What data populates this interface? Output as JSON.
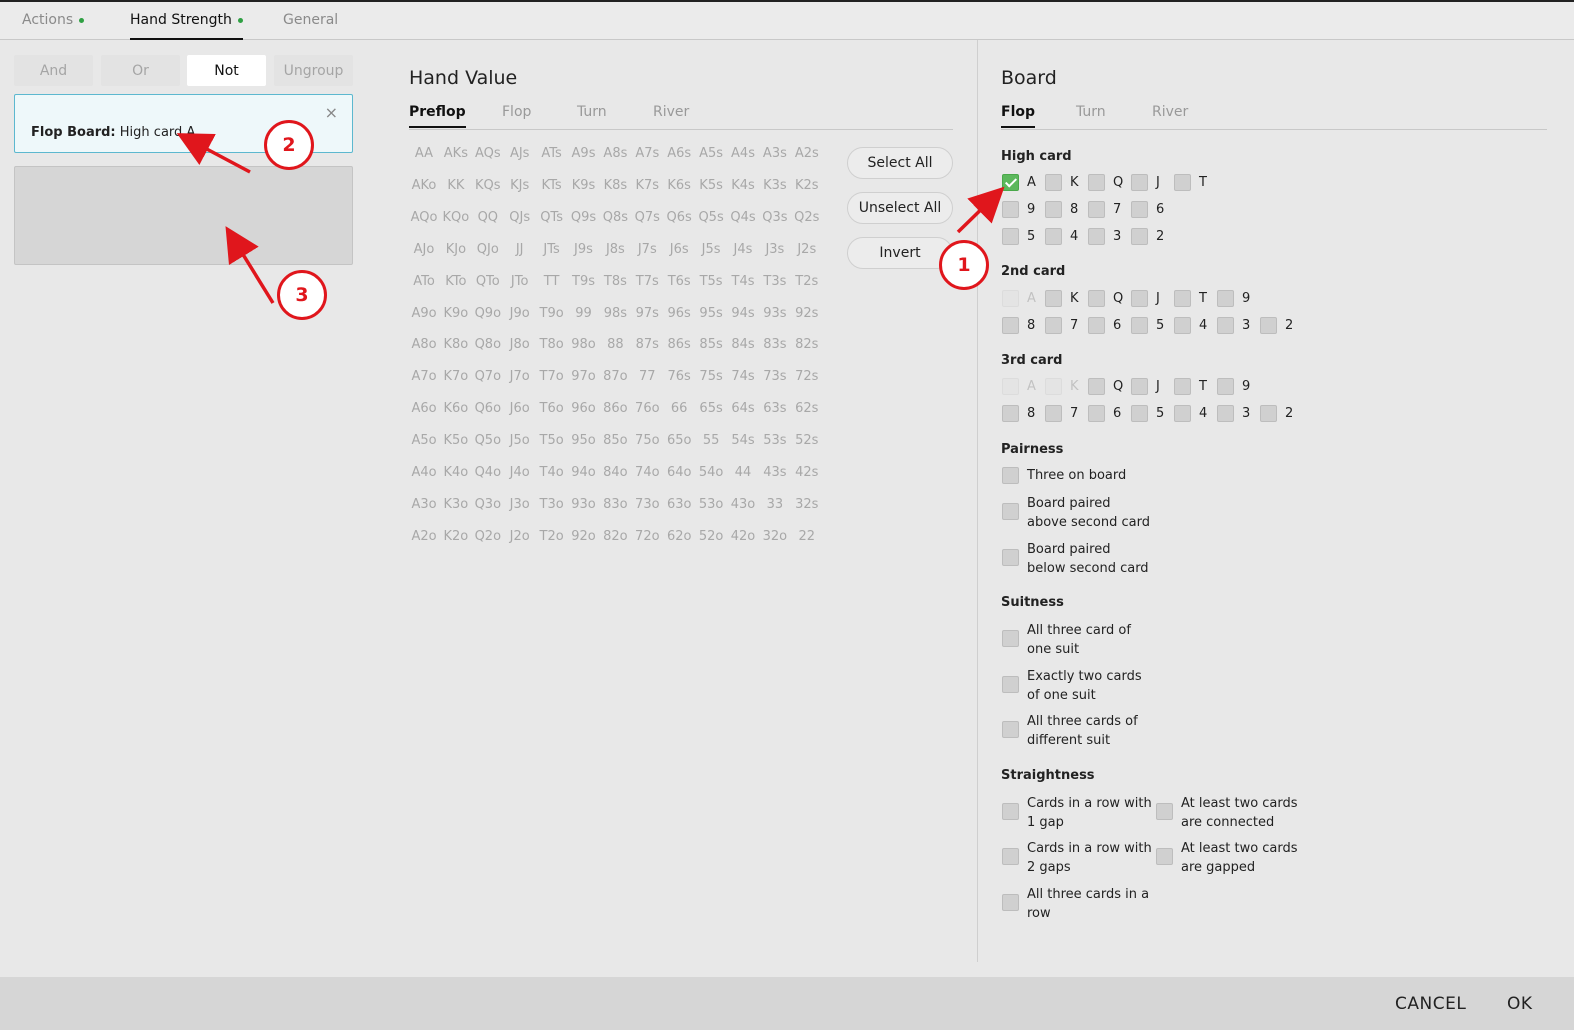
{
  "tabs": [
    {
      "label": "Actions",
      "dot": true
    },
    {
      "label": "Hand Strength",
      "dot": true
    },
    {
      "label": "General",
      "dot": false
    }
  ],
  "logic": {
    "and": "And",
    "or": "Or",
    "not": "Not",
    "ungroup": "Ungroup"
  },
  "filter": {
    "prefix": "Flop Board:",
    "value": "High card A",
    "close": "×"
  },
  "hand_value": {
    "title": "Hand Value",
    "tabs": [
      "Preflop",
      "Flop",
      "Turn",
      "River"
    ],
    "matrix": [
      [
        "AA",
        "AKs",
        "AQs",
        "AJs",
        "ATs",
        "A9s",
        "A8s",
        "A7s",
        "A6s",
        "A5s",
        "A4s",
        "A3s",
        "A2s"
      ],
      [
        "AKo",
        "KK",
        "KQs",
        "KJs",
        "KTs",
        "K9s",
        "K8s",
        "K7s",
        "K6s",
        "K5s",
        "K4s",
        "K3s",
        "K2s"
      ],
      [
        "AQo",
        "KQo",
        "QQ",
        "QJs",
        "QTs",
        "Q9s",
        "Q8s",
        "Q7s",
        "Q6s",
        "Q5s",
        "Q4s",
        "Q3s",
        "Q2s"
      ],
      [
        "AJo",
        "KJo",
        "QJo",
        "JJ",
        "JTs",
        "J9s",
        "J8s",
        "J7s",
        "J6s",
        "J5s",
        "J4s",
        "J3s",
        "J2s"
      ],
      [
        "ATo",
        "KTo",
        "QTo",
        "JTo",
        "TT",
        "T9s",
        "T8s",
        "T7s",
        "T6s",
        "T5s",
        "T4s",
        "T3s",
        "T2s"
      ],
      [
        "A9o",
        "K9o",
        "Q9o",
        "J9o",
        "T9o",
        "99",
        "98s",
        "97s",
        "96s",
        "95s",
        "94s",
        "93s",
        "92s"
      ],
      [
        "A8o",
        "K8o",
        "Q8o",
        "J8o",
        "T8o",
        "98o",
        "88",
        "87s",
        "86s",
        "85s",
        "84s",
        "83s",
        "82s"
      ],
      [
        "A7o",
        "K7o",
        "Q7o",
        "J7o",
        "T7o",
        "97o",
        "87o",
        "77",
        "76s",
        "75s",
        "74s",
        "73s",
        "72s"
      ],
      [
        "A6o",
        "K6o",
        "Q6o",
        "J6o",
        "T6o",
        "96o",
        "86o",
        "76o",
        "66",
        "65s",
        "64s",
        "63s",
        "62s"
      ],
      [
        "A5o",
        "K5o",
        "Q5o",
        "J5o",
        "T5o",
        "95o",
        "85o",
        "75o",
        "65o",
        "55",
        "54s",
        "53s",
        "52s"
      ],
      [
        "A4o",
        "K4o",
        "Q4o",
        "J4o",
        "T4o",
        "94o",
        "84o",
        "74o",
        "64o",
        "54o",
        "44",
        "43s",
        "42s"
      ],
      [
        "A3o",
        "K3o",
        "Q3o",
        "J3o",
        "T3o",
        "93o",
        "83o",
        "73o",
        "63o",
        "53o",
        "43o",
        "33",
        "32s"
      ],
      [
        "A2o",
        "K2o",
        "Q2o",
        "J2o",
        "T2o",
        "92o",
        "82o",
        "72o",
        "62o",
        "52o",
        "42o",
        "32o",
        "22"
      ]
    ],
    "buttons": {
      "select_all": "Select All",
      "unselect_all": "Unselect All",
      "invert": "Invert"
    }
  },
  "board": {
    "title": "Board",
    "tabs": [
      "Flop",
      "Turn",
      "River"
    ],
    "high_card": {
      "label": "High card",
      "rows": [
        [
          {
            "t": "A",
            "checked": true
          },
          {
            "t": "K"
          },
          {
            "t": "Q"
          },
          {
            "t": "J"
          },
          {
            "t": "T"
          }
        ],
        [
          {
            "t": "9"
          },
          {
            "t": "8"
          },
          {
            "t": "7"
          },
          {
            "t": "6"
          }
        ],
        [
          {
            "t": "5"
          },
          {
            "t": "4"
          },
          {
            "t": "3"
          },
          {
            "t": "2"
          }
        ]
      ]
    },
    "second_card": {
      "label": "2nd card",
      "rows": [
        [
          {
            "t": "A",
            "disabled": true
          },
          {
            "t": "K"
          },
          {
            "t": "Q"
          },
          {
            "t": "J"
          },
          {
            "t": "T"
          },
          {
            "t": "9"
          }
        ],
        [
          {
            "t": "8"
          },
          {
            "t": "7"
          },
          {
            "t": "6"
          },
          {
            "t": "5"
          },
          {
            "t": "4"
          },
          {
            "t": "3"
          },
          {
            "t": "2"
          }
        ]
      ]
    },
    "third_card": {
      "label": "3rd card",
      "rows": [
        [
          {
            "t": "A",
            "disabled": true
          },
          {
            "t": "K",
            "disabled": true
          },
          {
            "t": "Q"
          },
          {
            "t": "J"
          },
          {
            "t": "T"
          },
          {
            "t": "9"
          }
        ],
        [
          {
            "t": "8"
          },
          {
            "t": "7"
          },
          {
            "t": "6"
          },
          {
            "t": "5"
          },
          {
            "t": "4"
          },
          {
            "t": "3"
          },
          {
            "t": "2"
          }
        ]
      ]
    },
    "pairness": {
      "label": "Pairness",
      "items": [
        "Three on board",
        "Board paired\nabove second card",
        "Board paired\nbelow second card"
      ]
    },
    "suitness": {
      "label": "Suitness",
      "items": [
        "All three card of\none suit",
        "Exactly two cards\nof one suit",
        "All three cards of\ndifferent suit"
      ]
    },
    "straightness": {
      "label": "Straightness",
      "left": [
        "Cards in a row with\n1 gap",
        "Cards in a row with\n2 gaps",
        "All three cards in a\nrow"
      ],
      "right": [
        "At least two cards\nare connected",
        "At least two cards\nare gapped"
      ]
    }
  },
  "footer": {
    "cancel": "CANCEL",
    "ok": "OK"
  },
  "annotations": [
    "1",
    "2",
    "3"
  ],
  "colors": {
    "annotation": "#e0161c",
    "check": "#5cb85c",
    "card_border": "#5cb8cf"
  }
}
